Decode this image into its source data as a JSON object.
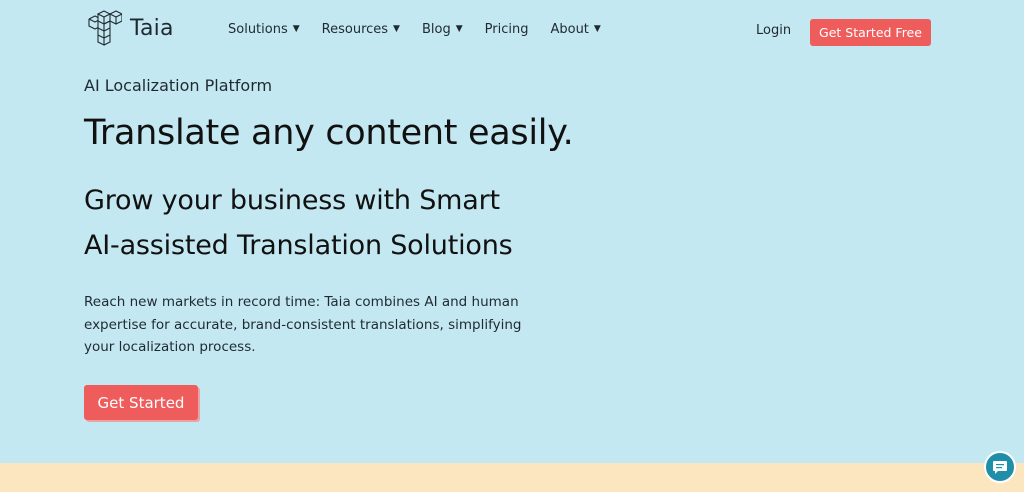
{
  "brand": {
    "name": "Taia"
  },
  "nav": {
    "items": [
      {
        "label": "Solutions",
        "has_dropdown": true
      },
      {
        "label": "Resources",
        "has_dropdown": true
      },
      {
        "label": "Blog",
        "has_dropdown": true
      },
      {
        "label": "Pricing",
        "has_dropdown": false
      },
      {
        "label": "About",
        "has_dropdown": true
      }
    ],
    "login_label": "Login",
    "cta_label": "Get Started Free"
  },
  "hero": {
    "eyebrow": "AI Localization Platform",
    "headline": "Translate any content easily.",
    "subheadline_line1": "Grow your business with Smart",
    "subheadline_line2": "AI-assisted Translation Solutions",
    "description": "Reach new markets in record time: Taia combines AI and human expertise for accurate, brand-consistent translations, simplifying your localization process.",
    "cta_label": "Get Started"
  },
  "colors": {
    "background": "#c4e8f1",
    "accent": "#ef5c5c",
    "bottom_band": "#fbe6bf",
    "chat_button": "#1f8ea8"
  },
  "icons": {
    "logo": "stacked-cubes-logo-icon",
    "caret": "caret-down-icon",
    "chat": "chat-bubble-icon"
  }
}
